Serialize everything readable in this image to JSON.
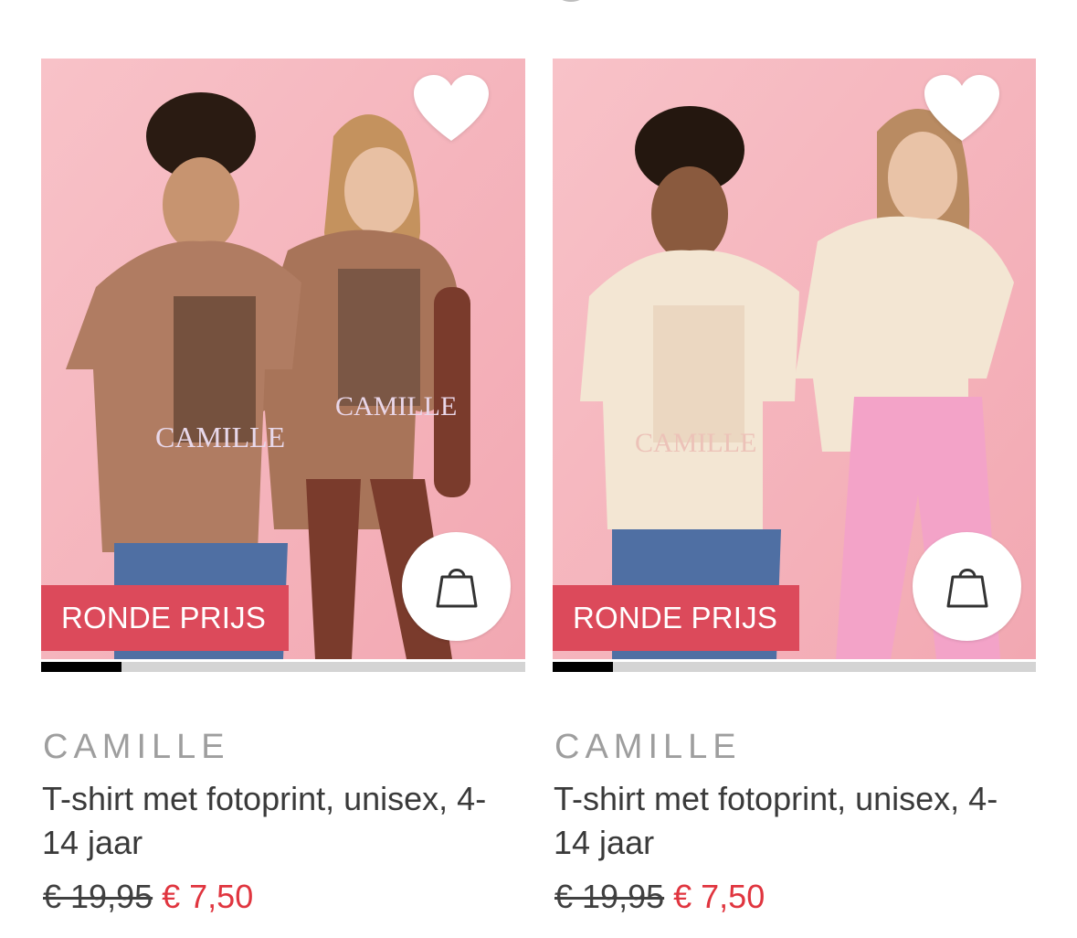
{
  "products": [
    {
      "brand": "CAMILLE",
      "title": "T-shirt met fotoprint, unisex, 4-14 jaar",
      "old_price": "€ 19,95",
      "new_price": "€ 7,50",
      "badge": "RONDE PRIJS",
      "image_progress_fraction": 0.166,
      "shirt_color": "#b07c62",
      "icons": {
        "wishlist": "heart-icon",
        "cart": "shopping-bag-icon"
      }
    },
    {
      "brand": "CAMILLE",
      "title": "T-shirt met fotoprint, unisex, 4-14 jaar",
      "old_price": "€ 19,95",
      "new_price": "€ 7,50",
      "badge": "RONDE PRIJS",
      "image_progress_fraction": 0.125,
      "shirt_color": "#f3e6d3",
      "icons": {
        "wishlist": "heart-icon",
        "cart": "shopping-bag-icon"
      }
    }
  ],
  "colors": {
    "badge_bg": "#dc4a5b",
    "sale_price": "#e0353f",
    "photo_background": "#f6b6be"
  }
}
